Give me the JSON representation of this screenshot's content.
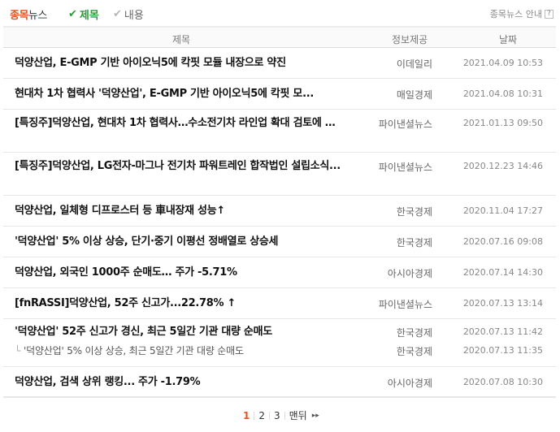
{
  "header": {
    "brand_a": "종목",
    "brand_b": "뉴스",
    "filters": [
      {
        "label": "제목",
        "active": true
      },
      {
        "label": "내용",
        "active": false
      }
    ],
    "guide": "종목뉴스 안내",
    "guide_icon": "?"
  },
  "table": {
    "columns": [
      "제목",
      "정보제공",
      "날짜"
    ],
    "rows": [
      {
        "title": "덕양산업, E-GMP 기반 아이오닉5에 칵핏 모듈 내장으로 약진",
        "source": "이데일리",
        "date": "2021.04.09 10:53"
      },
      {
        "title": "현대차 1차 협력사 '덕양산업', E-GMP 기반 아이오닉5에 칵핏 모...",
        "source": "매일경제",
        "date": "2021.04.08 10:31"
      },
      {
        "title": "[특징주]덕양산업, 현대차 1차 협력사…수소전기차 라인업 확대 검토에 …",
        "source": "파이낸셜뉴스",
        "date": "2021.01.13 09:50"
      },
      {
        "title": "[특징주]덕양산업, LG전자-마그나 전기차 파워트레인 합작법인 설립소식...",
        "source": "파이낸셜뉴스",
        "date": "2020.12.23 14:46"
      },
      {
        "title": "덕양산업, 일체형 디프로스터 등 車내장재 성능↑",
        "source": "한국경제",
        "date": "2020.11.04 17:27"
      },
      {
        "title": "'덕양산업' 5% 이상 상승, 단기·중기 이평선 정배열로 상승세",
        "source": "한국경제",
        "date": "2020.07.16 09:08"
      },
      {
        "title": "덕양산업, 외국인 1000주 순매도… 주가 -5.71%",
        "source": "아시아경제",
        "date": "2020.07.14 14:30"
      },
      {
        "title": "[fnRASSI]덕양산업, 52주 신고가...22.78% ↑",
        "source": "파이낸셜뉴스",
        "date": "2020.07.13 13:14"
      },
      {
        "title": "'덕양산업' 52주 신고가 경신, 최근 5일간 기관 대량 순매도",
        "source": "한국경제",
        "date": "2020.07.13 11:42",
        "sub": {
          "title": "'덕양산업' 5% 이상 상승, 최근 5일간 기관 대량 순매도",
          "source": "한국경제",
          "date": "2020.07.13 11:35"
        }
      },
      {
        "title": "덕양산업, 검색 상위 랭킹... 주가 -1.79%",
        "source": "아시아경제",
        "date": "2020.07.08 10:30"
      }
    ]
  },
  "pagination": {
    "pages": [
      "1",
      "2",
      "3"
    ],
    "current": "1",
    "last_label": "맨뒤",
    "next_icon": "▸▸"
  },
  "colors": {
    "accent": "#e8511f",
    "check_active": "#2e9a3a"
  }
}
